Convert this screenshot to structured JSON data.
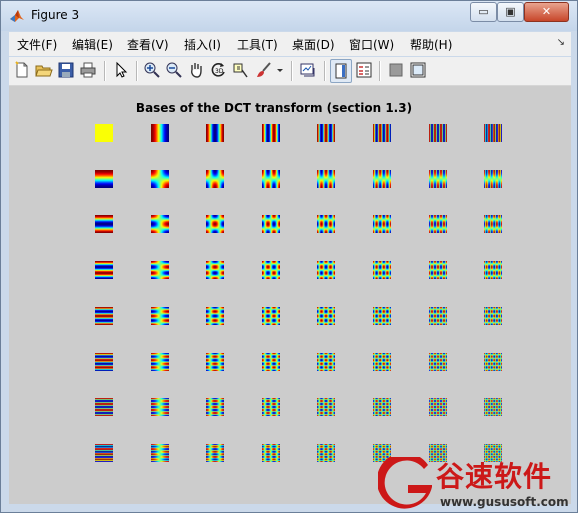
{
  "window": {
    "title": "Figure 3",
    "controls": {
      "minimize": "▭",
      "maximize": "▣",
      "close": "✕"
    }
  },
  "menu": [
    {
      "label": "文件(F)",
      "name": "menu-file"
    },
    {
      "label": "编辑(E)",
      "name": "menu-edit"
    },
    {
      "label": "查看(V)",
      "name": "menu-view"
    },
    {
      "label": "插入(I)",
      "name": "menu-insert"
    },
    {
      "label": "工具(T)",
      "name": "menu-tools"
    },
    {
      "label": "桌面(D)",
      "name": "menu-desktop"
    },
    {
      "label": "窗口(W)",
      "name": "menu-window"
    },
    {
      "label": "帮助(H)",
      "name": "menu-help"
    }
  ],
  "menu_overflow": "↘",
  "toolbar": [
    {
      "name": "new-figure-icon"
    },
    {
      "name": "open-file-icon"
    },
    {
      "name": "save-icon"
    },
    {
      "name": "print-icon"
    },
    {
      "name": "edit-plot-icon"
    },
    {
      "name": "zoom-in-icon"
    },
    {
      "name": "zoom-out-icon"
    },
    {
      "name": "pan-icon"
    },
    {
      "name": "rotate-3d-icon"
    },
    {
      "name": "data-cursor-icon"
    },
    {
      "name": "brush-icon"
    },
    {
      "name": "link-plot-icon"
    },
    {
      "name": "colorbar-icon"
    },
    {
      "name": "legend-icon"
    },
    {
      "name": "hide-plot-tools-icon"
    },
    {
      "name": "show-plot-tools-icon"
    }
  ],
  "figure": {
    "title": "Bases of the DCT transform (section 1.3)",
    "grid_rows": 8,
    "grid_cols": 8,
    "colormap": "jet"
  },
  "watermark": {
    "chinese": "谷速软件",
    "url": "www.gususoft.com",
    "brand_color": "#cc1818"
  }
}
